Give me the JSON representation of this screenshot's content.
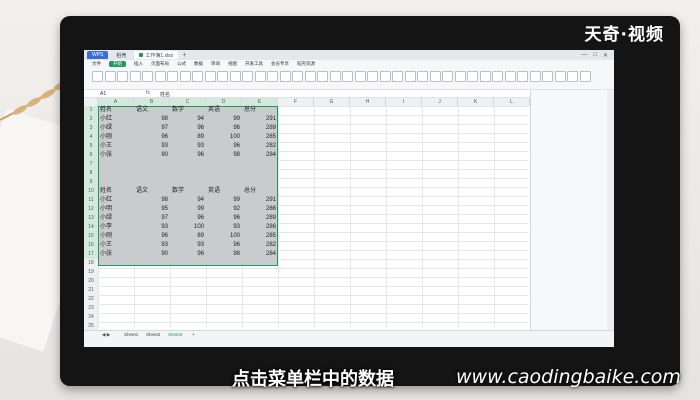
{
  "brand": "天奇·视频",
  "subtitle": "点击菜单栏中的数据",
  "watermark": "www.caodingbaike.com",
  "app": {
    "tabs": [
      {
        "label": "WPS",
        "kind": "home"
      },
      {
        "label": "稻壳"
      },
      {
        "label": "工作簿1.xlsx",
        "kind": "active"
      }
    ],
    "menu": [
      "文件",
      "开始",
      "插入",
      "页面布局",
      "公式",
      "数据",
      "审阅",
      "视图",
      "开发工具",
      "会员专享",
      "稻壳资源"
    ],
    "active_menu": "开始",
    "formula": {
      "namebox": "A1",
      "fx": "fx",
      "value": "姓名"
    }
  },
  "sheet": {
    "columns": [
      "A",
      "B",
      "C",
      "D",
      "E",
      "F",
      "G",
      "H",
      "I",
      "J",
      "K",
      "L"
    ],
    "selected_columns": [
      "A",
      "B",
      "C",
      "D",
      "E"
    ],
    "row_numbers": [
      1,
      2,
      3,
      4,
      5,
      6,
      7,
      8,
      9,
      10,
      11,
      12,
      13,
      14,
      15,
      16,
      17,
      18,
      19,
      20,
      21,
      22,
      23,
      24,
      25
    ],
    "selected_row_count": 17,
    "table1": {
      "headers": [
        "姓名",
        "语文",
        "数学",
        "英语",
        "总分"
      ],
      "rows": [
        [
          "小红",
          "98",
          "94",
          "99",
          "291"
        ],
        [
          "小绿",
          "97",
          "96",
          "96",
          "289"
        ],
        [
          "小刚",
          "96",
          "89",
          "100",
          "285"
        ],
        [
          "小王",
          "93",
          "93",
          "96",
          "282"
        ],
        [
          "小张",
          "90",
          "96",
          "98",
          "284"
        ]
      ]
    },
    "table2": {
      "headers": [
        "姓名",
        "语文",
        "数学",
        "英语",
        "总分"
      ],
      "rows": [
        [
          "小红",
          "98",
          "94",
          "99",
          "291"
        ],
        [
          "小明",
          "95",
          "99",
          "92",
          "286"
        ],
        [
          "小绿",
          "97",
          "96",
          "96",
          "289"
        ],
        [
          "小李",
          "93",
          "100",
          "93",
          "286"
        ],
        [
          "小刚",
          "96",
          "89",
          "100",
          "285"
        ],
        [
          "小王",
          "93",
          "93",
          "96",
          "282"
        ],
        [
          "小张",
          "90",
          "96",
          "98",
          "284"
        ]
      ]
    },
    "sheet_tabs": [
      "Sheet1",
      "Sheet2",
      "Sheet3"
    ],
    "active_sheet": "Sheet3"
  }
}
